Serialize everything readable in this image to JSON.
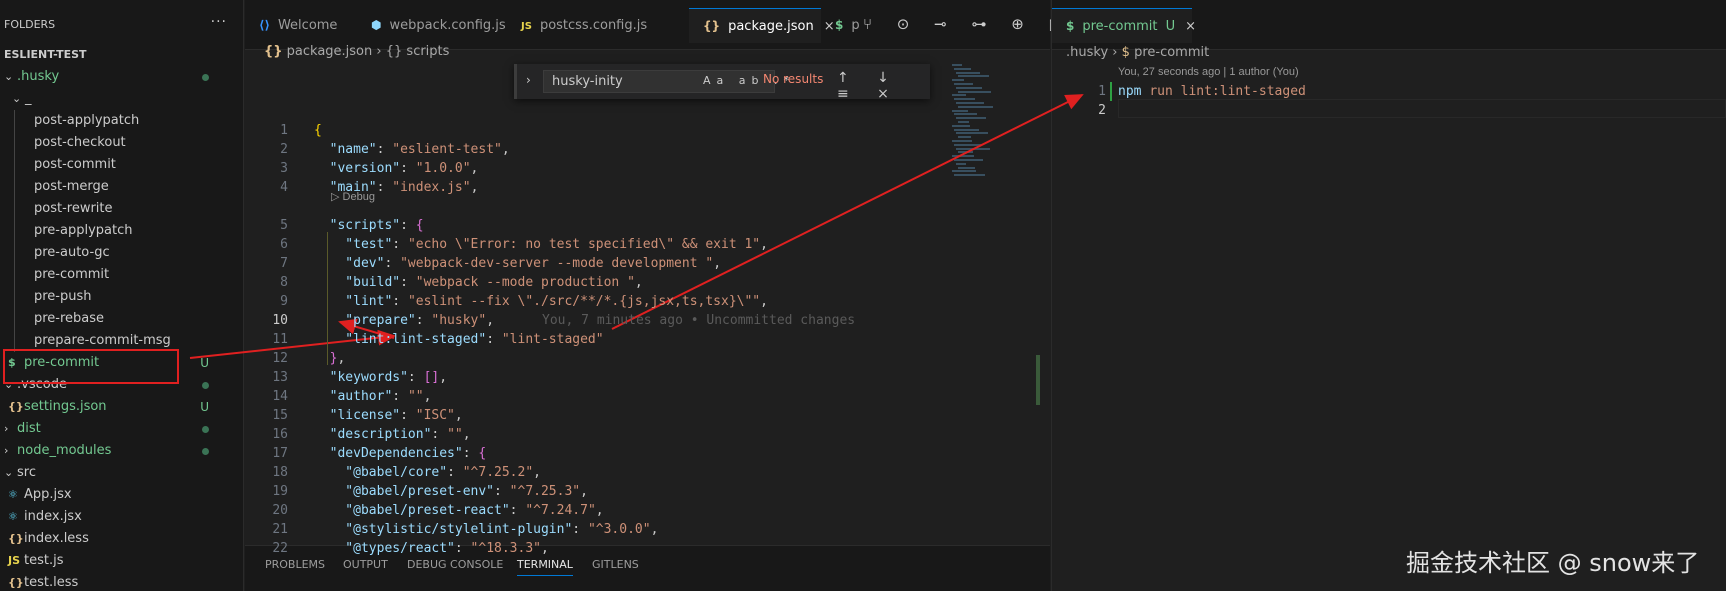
{
  "sidebar": {
    "header": "FOLDERS",
    "more": "···",
    "project": "ESLIENT-TEST",
    "items": [
      {
        "chev": "⌄",
        "label": ".husky",
        "status": "dot"
      },
      {
        "chev": "⌄",
        "label": "_"
      },
      {
        "label": "post-applypatch"
      },
      {
        "label": "post-checkout"
      },
      {
        "label": "post-commit"
      },
      {
        "label": "post-merge"
      },
      {
        "label": "post-rewrite"
      },
      {
        "label": "pre-applypatch"
      },
      {
        "label": "pre-auto-gc"
      },
      {
        "label": "pre-commit"
      },
      {
        "label": "pre-push"
      },
      {
        "label": "pre-rebase"
      },
      {
        "label": "prepare-commit-msg"
      },
      {
        "icon": "$",
        "label": "pre-commit",
        "status": "U"
      },
      {
        "chev": "⌄",
        "label": ".vscode",
        "status": "dot"
      },
      {
        "icon": "{}",
        "label": "settings.json",
        "status": "U"
      },
      {
        "chev": "›",
        "label": "dist",
        "status": "dot"
      },
      {
        "chev": "›",
        "label": "node_modules",
        "status": "dot"
      },
      {
        "chev": "⌄",
        "label": "src"
      },
      {
        "icon": "⚛",
        "label": "App.jsx"
      },
      {
        "icon": "⚛",
        "label": "index.jsx"
      },
      {
        "icon": "{}",
        "label": "index.less"
      },
      {
        "icon": "JS",
        "label": "test.js"
      },
      {
        "icon": "{}",
        "label": "test.less"
      }
    ]
  },
  "tabs": [
    {
      "icon": "⟨⟩",
      "label": "Welcome"
    },
    {
      "icon": "⬢",
      "label": "webpack.config.js"
    },
    {
      "icon": "JS",
      "label": "postcss.config.js"
    },
    {
      "icon": "{}",
      "label": "package.json",
      "active": true,
      "close": "×"
    },
    {
      "icon": "$",
      "label": "p"
    }
  ],
  "editor_actions": "⑂ ⊙ ⊸ ⊶ ⊕ ▯ ⋯",
  "breadcrumb": {
    "file_icon": "{}",
    "file": "package.json",
    "sep": "›",
    "sym_icon": "{}",
    "symbol": "scripts"
  },
  "find": {
    "value": "husky-inity",
    "options": "Aa ab .*",
    "result": "No results",
    "nav": "↑ ↓ ≡ ×"
  },
  "codelens": "▷ Debug",
  "code": {
    "line_numbers": [
      "1",
      "2",
      "3",
      "4",
      "5",
      "6",
      "7",
      "8",
      "9",
      "10",
      "11",
      "12",
      "13",
      "14",
      "15",
      "16",
      "17",
      "18",
      "19",
      "20",
      "21",
      "22"
    ],
    "current_line": "10",
    "blame": "You, 7 minutes ago • Uncommitted changes",
    "lines": [
      {
        "t": [
          [
            "b1",
            "{"
          ]
        ]
      },
      {
        "t": [
          [
            "k",
            "  \"name\""
          ],
          [
            "p",
            ": "
          ],
          [
            "s",
            "\"eslient-test\""
          ],
          [
            "p",
            ","
          ]
        ]
      },
      {
        "t": [
          [
            "k",
            "  \"version\""
          ],
          [
            "p",
            ": "
          ],
          [
            "s",
            "\"1.0.0\""
          ],
          [
            "p",
            ","
          ]
        ]
      },
      {
        "t": [
          [
            "k",
            "  \"main\""
          ],
          [
            "p",
            ": "
          ],
          [
            "s",
            "\"index.js\""
          ],
          [
            "p",
            ","
          ]
        ]
      },
      {
        "t": [
          [
            "k",
            "  \"scripts\""
          ],
          [
            "p",
            ": "
          ],
          [
            "b2",
            "{"
          ]
        ]
      },
      {
        "t": [
          [
            "k",
            "    \"test\""
          ],
          [
            "p",
            ": "
          ],
          [
            "s",
            "\"echo \\\"Error: no test specified\\\" && exit 1\""
          ],
          [
            "p",
            ","
          ]
        ]
      },
      {
        "t": [
          [
            "k",
            "    \"dev\""
          ],
          [
            "p",
            ": "
          ],
          [
            "s",
            "\"webpack-dev-server --mode development \""
          ],
          [
            "p",
            ","
          ]
        ]
      },
      {
        "t": [
          [
            "k",
            "    \"build\""
          ],
          [
            "p",
            ": "
          ],
          [
            "s",
            "\"webpack --mode production \""
          ],
          [
            "p",
            ","
          ]
        ]
      },
      {
        "t": [
          [
            "k",
            "    \"lint\""
          ],
          [
            "p",
            ": "
          ],
          [
            "s",
            "\"eslint --fix \\\"./src/**/*.{js,jsx,ts,tsx}\\\"\""
          ],
          [
            "p",
            ","
          ]
        ]
      },
      {
        "t": [
          [
            "k",
            "    \"prepare\""
          ],
          [
            "p",
            ": "
          ],
          [
            "s",
            "\"husky\""
          ],
          [
            "p",
            ","
          ]
        ]
      },
      {
        "t": [
          [
            "k",
            "    \"lint:lint-staged\""
          ],
          [
            "p",
            ": "
          ],
          [
            "s",
            "\"lint-staged\""
          ]
        ]
      },
      {
        "t": [
          [
            "b2",
            "  }"
          ],
          [
            "p",
            ","
          ]
        ]
      },
      {
        "t": [
          [
            "k",
            "  \"keywords\""
          ],
          [
            "p",
            ": "
          ],
          [
            "b2",
            "[]"
          ],
          [
            "p",
            ","
          ]
        ]
      },
      {
        "t": [
          [
            "k",
            "  \"author\""
          ],
          [
            "p",
            ": "
          ],
          [
            "s",
            "\"\""
          ],
          [
            "p",
            ","
          ]
        ]
      },
      {
        "t": [
          [
            "k",
            "  \"license\""
          ],
          [
            "p",
            ": "
          ],
          [
            "s",
            "\"ISC\""
          ],
          [
            "p",
            ","
          ]
        ]
      },
      {
        "t": [
          [
            "k",
            "  \"description\""
          ],
          [
            "p",
            ": "
          ],
          [
            "s",
            "\"\""
          ],
          [
            "p",
            ","
          ]
        ]
      },
      {
        "t": [
          [
            "k",
            "  \"devDependencies\""
          ],
          [
            "p",
            ": "
          ],
          [
            "b2",
            "{"
          ]
        ]
      },
      {
        "t": [
          [
            "k",
            "    \"@babel/core\""
          ],
          [
            "p",
            ": "
          ],
          [
            "s",
            "\"^7.25.2\""
          ],
          [
            "p",
            ","
          ]
        ]
      },
      {
        "t": [
          [
            "k",
            "    \"@babel/preset-env\""
          ],
          [
            "p",
            ": "
          ],
          [
            "s",
            "\"^7.25.3\""
          ],
          [
            "p",
            ","
          ]
        ]
      },
      {
        "t": [
          [
            "k",
            "    \"@babel/preset-react\""
          ],
          [
            "p",
            ": "
          ],
          [
            "s",
            "\"^7.24.7\""
          ],
          [
            "p",
            ","
          ]
        ]
      },
      {
        "t": [
          [
            "k",
            "    \"@stylistic/stylelint-plugin\""
          ],
          [
            "p",
            ": "
          ],
          [
            "s",
            "\"^3.0.0\""
          ],
          [
            "p",
            ","
          ]
        ]
      },
      {
        "t": [
          [
            "k",
            "    \"@types/react\""
          ],
          [
            "p",
            ": "
          ],
          [
            "s",
            "\"^18.3.3\""
          ],
          [
            "p",
            ","
          ]
        ]
      }
    ]
  },
  "panel": {
    "tabs": [
      "PROBLEMS",
      "OUTPUT",
      "DEBUG CONSOLE",
      "TERMINAL",
      "GITLENS"
    ],
    "active": "TERMINAL"
  },
  "group2": {
    "tab": {
      "icon": "$",
      "label": "pre-commit",
      "status": "U",
      "close": "×"
    },
    "breadcrumb": {
      "folder": ".husky",
      "sep": "›",
      "file_icon": "$",
      "file": "pre-commit"
    },
    "blame_header": "You, 27 seconds ago | 1 author (You)",
    "line_numbers": [
      "1",
      "2"
    ],
    "lines": [
      {
        "t": [
          [
            "k",
            "npm"
          ],
          [
            "p",
            " "
          ],
          [
            "s",
            "run lint:lint-staged"
          ]
        ]
      },
      {
        "t": []
      }
    ]
  },
  "watermark": "掘金技术社区 @ snow来了",
  "colors": {
    "annotation": "#e02020",
    "accent": "#0078d4",
    "untracked": "#73c991"
  }
}
